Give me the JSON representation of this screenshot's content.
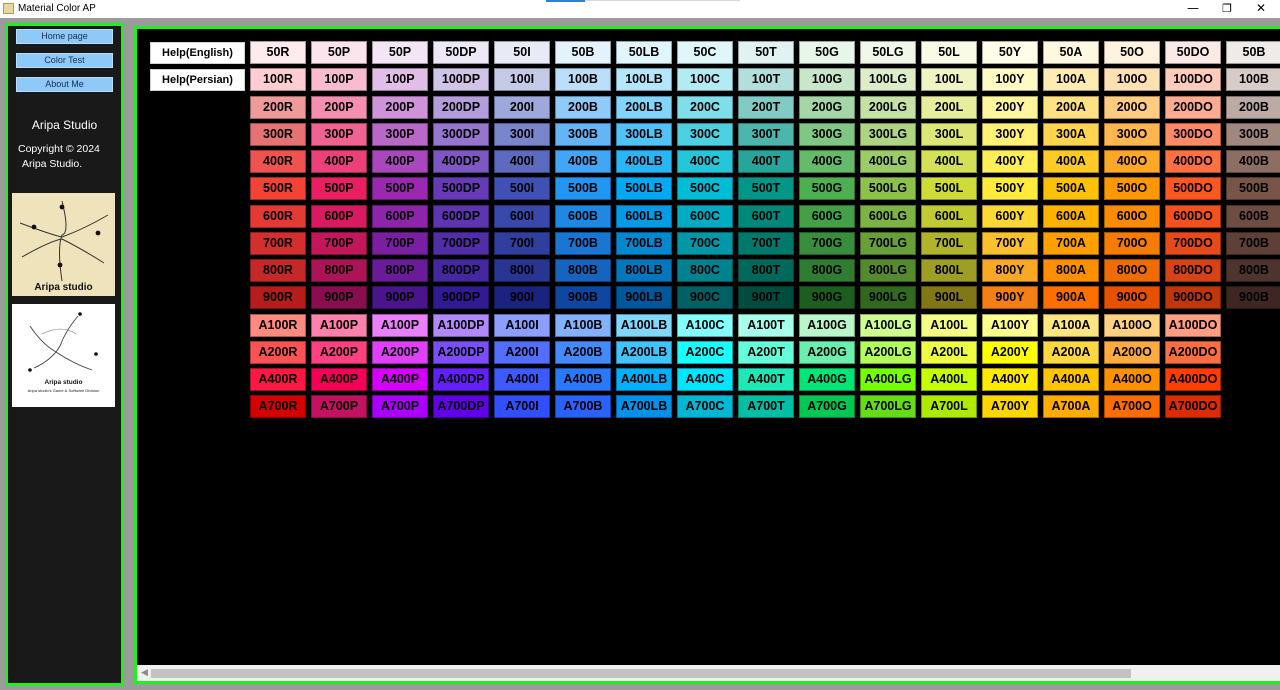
{
  "window": {
    "title": "Material Color AP",
    "controls": {
      "minimize": "—",
      "maximize": "❐",
      "close": "✕"
    }
  },
  "sidebar": {
    "nav": [
      "Home page",
      "Color Test",
      "About Me"
    ],
    "studio_name": "Aripa Studio",
    "copyright_line1": "Copyright © 2024",
    "copyright_line2": "Aripa Studio.",
    "logo1_caption": "Aripa studio",
    "logo2_caption": "Aripa studio",
    "logo2_subcaption": "Aripa studio's Game & Software Division"
  },
  "help_buttons": {
    "english": "Help(English)",
    "persian": "Help(Persian)"
  },
  "palette": {
    "columns": [
      {
        "code": "R",
        "shades": {
          "50": "#FFEBEE",
          "100": "#FFCDD2",
          "200": "#EF9A9A",
          "300": "#E57373",
          "400": "#EF5350",
          "500": "#F44336",
          "600": "#E53935",
          "700": "#D32F2F",
          "800": "#C62828",
          "900": "#B71C1C",
          "A100": "#FF8A80",
          "A200": "#FF5252",
          "A400": "#FF1744",
          "A700": "#D50000"
        }
      },
      {
        "code": "P",
        "shades": {
          "50": "#FCE4EC",
          "100": "#F8BBD0",
          "200": "#F48FB1",
          "300": "#F06292",
          "400": "#EC407A",
          "500": "#E91E63",
          "600": "#D81B60",
          "700": "#C2185B",
          "800": "#AD1457",
          "900": "#880E4F",
          "A100": "#FF80AB",
          "A200": "#FF4081",
          "A400": "#F50057",
          "A700": "#C51162"
        }
      },
      {
        "code": "P",
        "shades": {
          "50": "#F3E5F5",
          "100": "#E1BEE7",
          "200": "#CE93D8",
          "300": "#BA68C8",
          "400": "#AB47BC",
          "500": "#9C27B0",
          "600": "#8E24AA",
          "700": "#7B1FA2",
          "800": "#6A1B9A",
          "900": "#4A148C",
          "A100": "#EA80FC",
          "A200": "#E040FB",
          "A400": "#D500F9",
          "A700": "#AA00FF"
        }
      },
      {
        "code": "DP",
        "shades": {
          "50": "#EDE7F6",
          "100": "#D1C4E9",
          "200": "#B39DDB",
          "300": "#9575CD",
          "400": "#7E57C2",
          "500": "#673AB7",
          "600": "#5E35B1",
          "700": "#512DA8",
          "800": "#4527A0",
          "900": "#311B92",
          "A100": "#B388FF",
          "A200": "#7C4DFF",
          "A400": "#651FFF",
          "A700": "#6200EA"
        }
      },
      {
        "code": "I",
        "shades": {
          "50": "#E8EAF6",
          "100": "#C5CAE9",
          "200": "#9FA8DA",
          "300": "#7986CB",
          "400": "#5C6BC0",
          "500": "#3F51B5",
          "600": "#3949AB",
          "700": "#303F9F",
          "800": "#283593",
          "900": "#1A237E",
          "A100": "#8C9EFF",
          "A200": "#536DFE",
          "A400": "#3D5AFE",
          "A700": "#304FFE"
        }
      },
      {
        "code": "B",
        "shades": {
          "50": "#E3F2FD",
          "100": "#BBDEFB",
          "200": "#90CAF9",
          "300": "#64B5F6",
          "400": "#42A5F5",
          "500": "#2196F3",
          "600": "#1E88E5",
          "700": "#1976D2",
          "800": "#1565C0",
          "900": "#0D47A1",
          "A100": "#82B1FF",
          "A200": "#448AFF",
          "A400": "#2979FF",
          "A700": "#2962FF"
        }
      },
      {
        "code": "LB",
        "shades": {
          "50": "#E1F5FE",
          "100": "#B3E5FC",
          "200": "#81D4FA",
          "300": "#4FC3F7",
          "400": "#29B6F6",
          "500": "#03A9F4",
          "600": "#039BE5",
          "700": "#0288D1",
          "800": "#0277BD",
          "900": "#01579B",
          "A100": "#80D8FF",
          "A200": "#40C4FF",
          "A400": "#00B0FF",
          "A700": "#0091EA"
        }
      },
      {
        "code": "C",
        "shades": {
          "50": "#E0F7FA",
          "100": "#B2EBF2",
          "200": "#80DEEA",
          "300": "#4DD0E1",
          "400": "#26C6DA",
          "500": "#00BCD4",
          "600": "#00ACC1",
          "700": "#0097A7",
          "800": "#00838F",
          "900": "#006064",
          "A100": "#84FFFF",
          "A200": "#18FFFF",
          "A400": "#00E5FF",
          "A700": "#00B8D4"
        }
      },
      {
        "code": "T",
        "shades": {
          "50": "#E0F2F1",
          "100": "#B2DFDB",
          "200": "#80CBC4",
          "300": "#4DB6AC",
          "400": "#26A69A",
          "500": "#009688",
          "600": "#00897B",
          "700": "#00796B",
          "800": "#00695C",
          "900": "#004D40",
          "A100": "#A7FFEB",
          "A200": "#64FFDA",
          "A400": "#1DE9B6",
          "A700": "#00BFA5"
        }
      },
      {
        "code": "G",
        "shades": {
          "50": "#E8F5E9",
          "100": "#C8E6C9",
          "200": "#A5D6A7",
          "300": "#81C784",
          "400": "#66BB6A",
          "500": "#4CAF50",
          "600": "#43A047",
          "700": "#388E3C",
          "800": "#2E7D32",
          "900": "#1B5E20",
          "A100": "#B9F6CA",
          "A200": "#69F0AE",
          "A400": "#00E676",
          "A700": "#00C853"
        }
      },
      {
        "code": "LG",
        "shades": {
          "50": "#F1F8E9",
          "100": "#DCEDC8",
          "200": "#C5E1A5",
          "300": "#AED581",
          "400": "#9CCC65",
          "500": "#8BC34A",
          "600": "#7CB342",
          "700": "#689F38",
          "800": "#558B2F",
          "900": "#33691E",
          "A100": "#CCFF90",
          "A200": "#B2FF59",
          "A400": "#76FF03",
          "A700": "#64DD17"
        }
      },
      {
        "code": "L",
        "shades": {
          "50": "#F9FBE7",
          "100": "#F0F4C3",
          "200": "#E6EE9C",
          "300": "#DCE775",
          "400": "#D4E157",
          "500": "#CDDC39",
          "600": "#C0CA33",
          "700": "#AFB42B",
          "800": "#9E9D24",
          "900": "#827717",
          "A100": "#F4FF81",
          "A200": "#EEFF41",
          "A400": "#C6FF00",
          "A700": "#AEEA00"
        }
      },
      {
        "code": "Y",
        "shades": {
          "50": "#FFFDE7",
          "100": "#FFF9C4",
          "200": "#FFF59D",
          "300": "#FFF176",
          "400": "#FFEE58",
          "500": "#FFEB3B",
          "600": "#FDD835",
          "700": "#FBC02D",
          "800": "#F9A825",
          "900": "#F57F17",
          "A100": "#FFFF8D",
          "A200": "#FFFF00",
          "A400": "#FFEA00",
          "A700": "#FFD600"
        }
      },
      {
        "code": "A",
        "shades": {
          "50": "#FFF8E1",
          "100": "#FFECB3",
          "200": "#FFE082",
          "300": "#FFD54F",
          "400": "#FFCA28",
          "500": "#FFC107",
          "600": "#FFB300",
          "700": "#FFA000",
          "800": "#FF8F00",
          "900": "#FF6F00",
          "A100": "#FFE57F",
          "A200": "#FFD740",
          "A400": "#FFC400",
          "A700": "#FFAB00"
        }
      },
      {
        "code": "O",
        "shades": {
          "50": "#FFF3E0",
          "100": "#FFE0B2",
          "200": "#FFCC80",
          "300": "#FFB74D",
          "400": "#FFA726",
          "500": "#FF9800",
          "600": "#FB8C00",
          "700": "#F57C00",
          "800": "#EF6C00",
          "900": "#E65100",
          "A100": "#FFD180",
          "A200": "#FFAB40",
          "A400": "#FF9100",
          "A700": "#FF6D00"
        }
      },
      {
        "code": "DO",
        "shades": {
          "50": "#FBE9E7",
          "100": "#FFCCBC",
          "200": "#FFAB91",
          "300": "#FF8A65",
          "400": "#FF7043",
          "500": "#FF5722",
          "600": "#F4511E",
          "700": "#E64A19",
          "800": "#D84315",
          "900": "#BF360C",
          "A100": "#FF9E80",
          "A200": "#FF6E40",
          "A400": "#FF3D00",
          "A700": "#DD2C00"
        }
      },
      {
        "code": "B",
        "shades": {
          "50": "#EFEBE9",
          "100": "#D7CCC8",
          "200": "#BCAAA4",
          "300": "#A1887F",
          "400": "#8D6E63",
          "500": "#795548",
          "600": "#6D4C41",
          "700": "#5D4037",
          "800": "#4E342E",
          "900": "#3E2723"
        }
      }
    ]
  }
}
